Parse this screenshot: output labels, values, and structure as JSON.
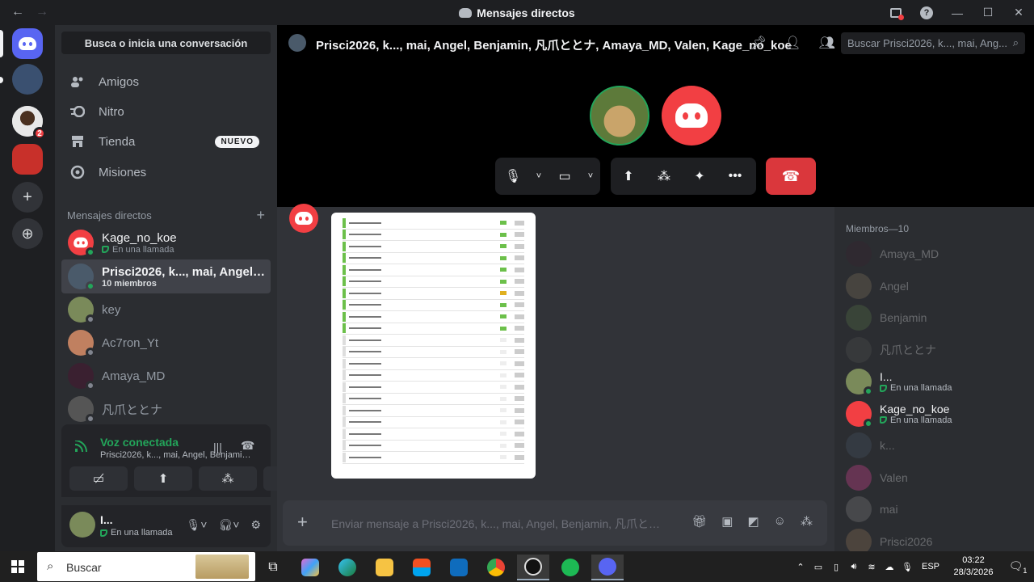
{
  "window": {
    "title": "Mensajes directos",
    "nav_back": "←",
    "nav_fwd": "→",
    "minimize": "—",
    "maximize": "☐",
    "close": "✕"
  },
  "rail": {
    "home_badge_count": "2",
    "discover": "⊕"
  },
  "sidebar": {
    "search_label": "Busca o inicia una conversación",
    "nav": [
      {
        "label": "Amigos",
        "icon": "friends-icon"
      },
      {
        "label": "Nitro",
        "icon": "nitro-icon"
      },
      {
        "label": "Tienda",
        "icon": "shop-icon",
        "badge": "NUEVO"
      },
      {
        "label": "Misiones",
        "icon": "quests-icon"
      }
    ],
    "dm_header": "Mensajes directos",
    "dms": [
      {
        "name": "Kage_no_koe",
        "sub": "En una llamada",
        "status": "online"
      },
      {
        "name": "Prisci2026, k..., mai, Angel, Be...",
        "sub": "10 miembros",
        "status": "online"
      },
      {
        "name": "key",
        "sub": "",
        "status": "offline"
      },
      {
        "name": "Ac7ron_Yt",
        "sub": "",
        "status": "offline"
      },
      {
        "name": "Amaya_MD",
        "sub": "",
        "status": "offline"
      },
      {
        "name": "凡爪ととナ",
        "sub": "",
        "status": "offline"
      }
    ],
    "voice": {
      "title": "Voz conectada",
      "channel": "Prisci2026, k..., mai, Angel, Benjamin, ..."
    },
    "user": {
      "name": "I...",
      "status": "En una llamada"
    }
  },
  "header": {
    "channel_name": "Prisci2026, k..., mai, Angel, Benjamin, 凡爪ととナ, Amaya_MD, Valen, Kage_no_koe",
    "search_placeholder": "Buscar Prisci2026, k..., mai, Ang..."
  },
  "composer": {
    "placeholder": "Enviar mensaje a Prisci2026, k..., mai, Angel, Benjamin, 凡爪ととナ..."
  },
  "members": {
    "header": "Miembros—10",
    "list": [
      {
        "name": "Amaya_MD",
        "sub": "",
        "dim": true,
        "color": "#3a2030"
      },
      {
        "name": "Angel",
        "sub": "",
        "dim": true,
        "color": "#8a7a60"
      },
      {
        "name": "Benjamin",
        "sub": "",
        "dim": true,
        "color": "#5a7a4a"
      },
      {
        "name": "凡爪ととナ",
        "sub": "",
        "dim": true,
        "color": "#555"
      },
      {
        "name": "I...",
        "sub": "En una llamada",
        "dim": false,
        "color": "#7a8a5a"
      },
      {
        "name": "Kage_no_koe",
        "sub": "En una llamada",
        "dim": false,
        "color": "#f23f43"
      },
      {
        "name": "k...",
        "sub": "",
        "dim": true,
        "color": "#4a5a6a"
      },
      {
        "name": "Valen",
        "sub": "",
        "dim": true,
        "color": "#eb459e"
      },
      {
        "name": "mai",
        "sub": "",
        "dim": true,
        "color": "#888"
      },
      {
        "name": "Prisci2026",
        "sub": "",
        "dim": true,
        "color": "#9a7a5a"
      }
    ]
  },
  "taskbar": {
    "search_label": "Buscar",
    "lang": "ESP",
    "time": "03:22",
    "date": "28/3/2026",
    "notif_count": "1"
  },
  "colors": {
    "blurple": "#5865f2",
    "red": "#f23f43",
    "green": "#23a55a"
  }
}
